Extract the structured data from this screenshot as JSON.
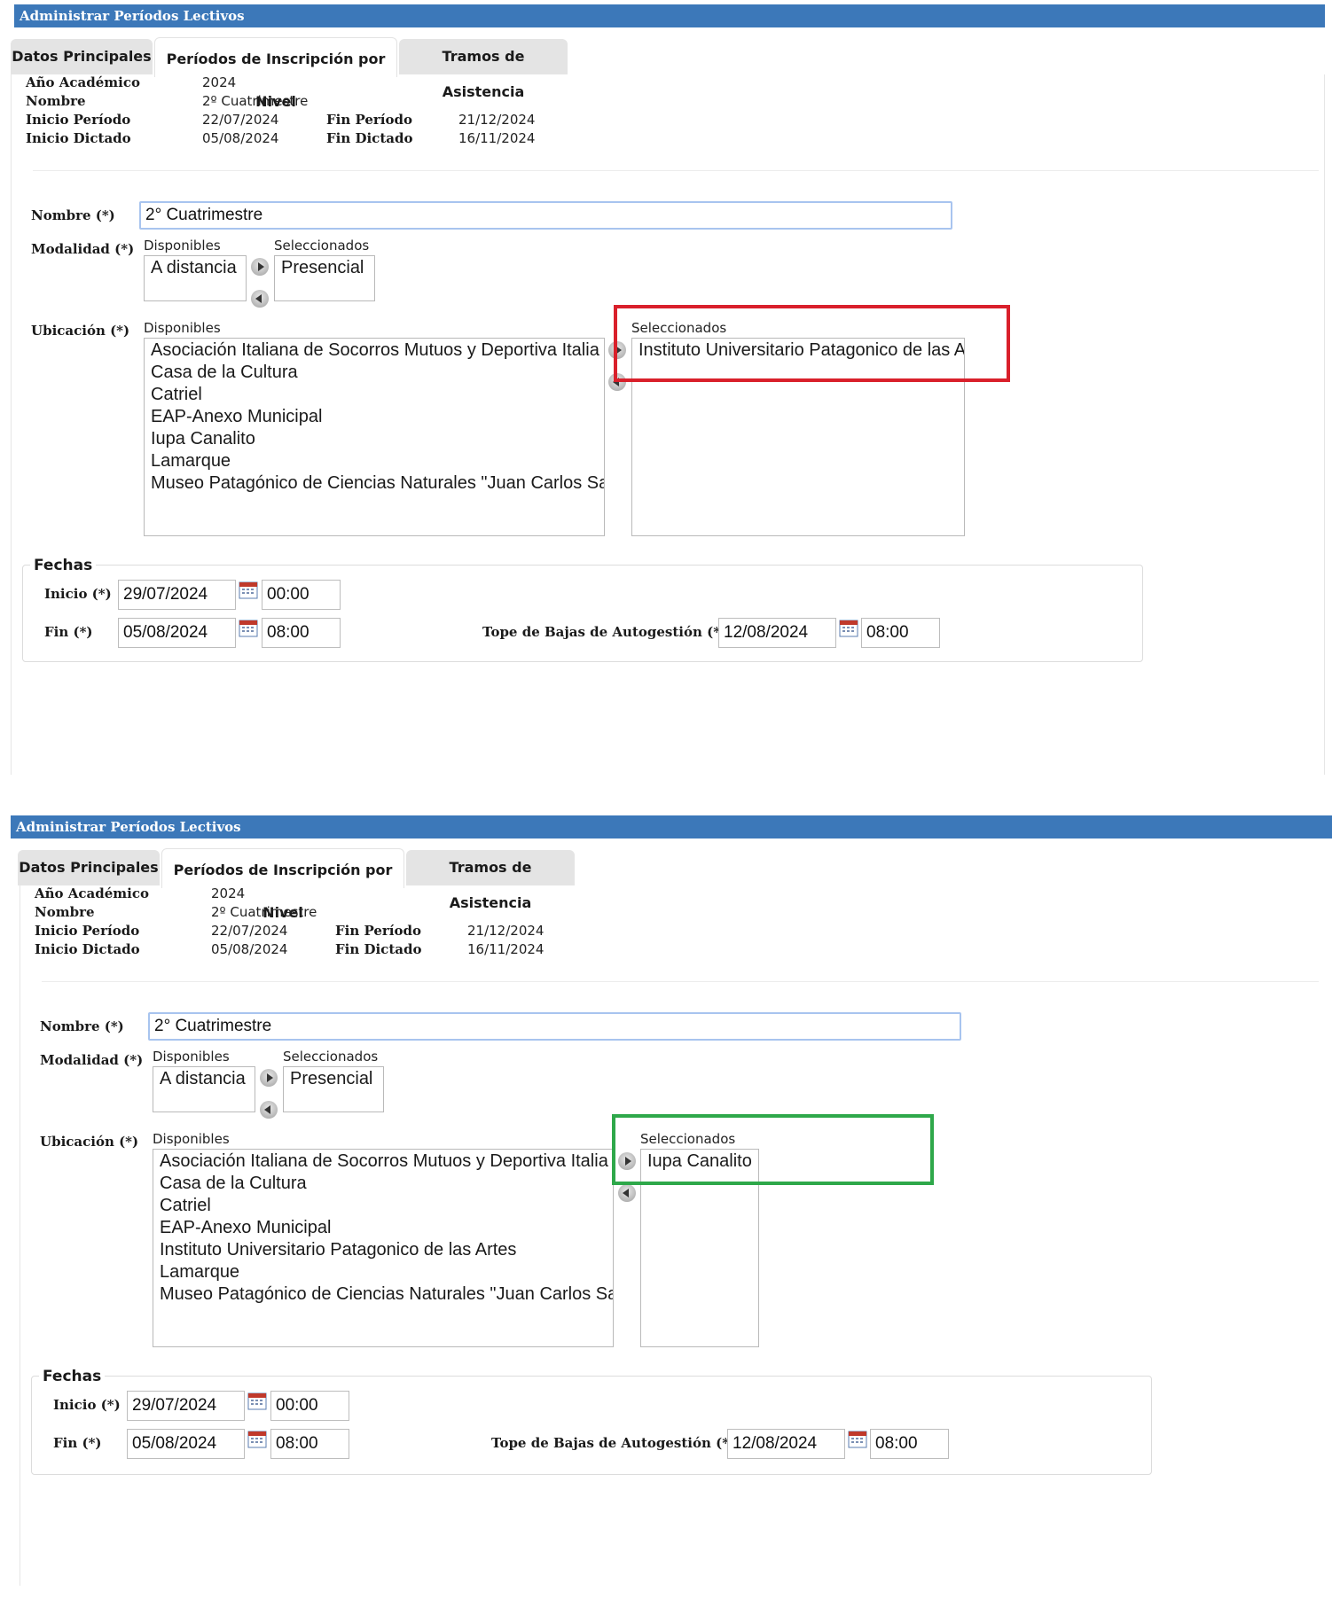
{
  "panels": [
    {
      "header": "Administrar Períodos Lectivos",
      "tabs": [
        "Datos Principales",
        "Períodos de Inscripción por Nivel",
        "Tramos de Asistencia"
      ],
      "info": {
        "anio_label": "Año Académico",
        "anio_value": "2024",
        "nombre_label": "Nombre",
        "nombre_value": "2º Cuatrimestre",
        "inicio_periodo_label": "Inicio Período",
        "inicio_periodo_value": "22/07/2024",
        "fin_periodo_label": "Fin Período",
        "fin_periodo_value": "21/12/2024",
        "inicio_dictado_label": "Inicio Dictado",
        "inicio_dictado_value": "05/08/2024",
        "fin_dictado_label": "Fin Dictado",
        "fin_dictado_value": "16/11/2024"
      },
      "form": {
        "nombre_label": "Nombre (*)",
        "nombre_value": "2° Cuatrimestre",
        "modalidad_label": "Modalidad (*)",
        "disponibles_label": "Disponibles",
        "seleccionados_label": "Seleccionados",
        "modalidad_disponibles": [
          "A distancia"
        ],
        "modalidad_seleccionados": [
          "Presencial"
        ],
        "ubicacion_label": "Ubicación (*)",
        "ubicacion_disponibles": [
          "Asociación Italiana de Socorros Mutuos y Deportiva Italia Unida",
          "Casa de la Cultura",
          "Catriel",
          "EAP-Anexo Municipal",
          "Iupa Canalito",
          "Lamarque",
          "Museo Patagónico de Ciencias Naturales \"Juan Carlos Salgado\""
        ],
        "ubicacion_seleccionados": [
          "Instituto Universitario Patagonico de las Artes"
        ]
      },
      "fechas": {
        "legend": "Fechas",
        "inicio_label": "Inicio (*)",
        "inicio_date": "29/07/2024",
        "inicio_time": "00:00",
        "fin_label": "Fin (*)",
        "fin_date": "05/08/2024",
        "fin_time": "08:00",
        "tope_label": "Tope de Bajas de Autogestión (*)",
        "tope_date": "12/08/2024",
        "tope_time": "08:00"
      },
      "highlight_color": "#d9202b"
    },
    {
      "header": "Administrar Períodos Lectivos",
      "tabs": [
        "Datos Principales",
        "Períodos de Inscripción por Nivel",
        "Tramos de Asistencia"
      ],
      "info": {
        "anio_label": "Año Académico",
        "anio_value": "2024",
        "nombre_label": "Nombre",
        "nombre_value": "2º Cuatrimestre",
        "inicio_periodo_label": "Inicio Período",
        "inicio_periodo_value": "22/07/2024",
        "fin_periodo_label": "Fin Período",
        "fin_periodo_value": "21/12/2024",
        "inicio_dictado_label": "Inicio Dictado",
        "inicio_dictado_value": "05/08/2024",
        "fin_dictado_label": "Fin Dictado",
        "fin_dictado_value": "16/11/2024"
      },
      "form": {
        "nombre_label": "Nombre (*)",
        "nombre_value": "2° Cuatrimestre",
        "modalidad_label": "Modalidad (*)",
        "disponibles_label": "Disponibles",
        "seleccionados_label": "Seleccionados",
        "modalidad_disponibles": [
          "A distancia"
        ],
        "modalidad_seleccionados": [
          "Presencial"
        ],
        "ubicacion_label": "Ubicación (*)",
        "ubicacion_disponibles": [
          "Asociación Italiana de Socorros Mutuos y Deportiva Italia Unida",
          "Casa de la Cultura",
          "Catriel",
          "EAP-Anexo Municipal",
          "Instituto Universitario Patagonico de las Artes",
          "Lamarque",
          "Museo Patagónico de Ciencias Naturales \"Juan Carlos Salgado\""
        ],
        "ubicacion_seleccionados": [
          "Iupa Canalito"
        ]
      },
      "fechas": {
        "legend": "Fechas",
        "inicio_label": "Inicio (*)",
        "inicio_date": "29/07/2024",
        "inicio_time": "00:00",
        "fin_label": "Fin (*)",
        "fin_date": "05/08/2024",
        "fin_time": "08:00",
        "tope_label": "Tope de Bajas de Autogestión (*)",
        "tope_date": "12/08/2024",
        "tope_time": "08:00"
      },
      "highlight_color": "#2ea84a"
    }
  ],
  "icons": {
    "arrow_right": "arrow-right-icon",
    "arrow_left": "arrow-left-icon",
    "calendar": "calendar-icon"
  }
}
